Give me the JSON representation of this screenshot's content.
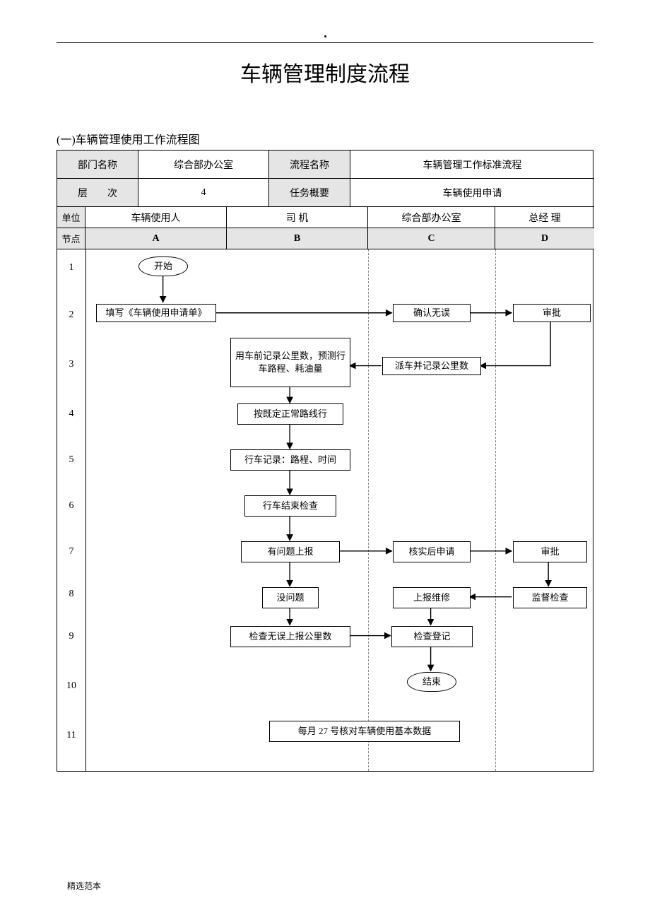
{
  "doc_title": "车辆管理制度流程",
  "section_title": "(一)车辆管理使用工作流程图",
  "footer": "精选范本",
  "header": {
    "dept_label": "部门名称",
    "dept_value": "综合部办公室",
    "flow_name_label": "流程名称",
    "flow_name_value": "车辆管理工作标准流程",
    "level_label": "层        次",
    "level_value": "4",
    "task_label": "任务概要",
    "task_value": "车辆使用申请",
    "unit_label": "单位",
    "node_label": "节点",
    "lanes": [
      {
        "unit": "车辆使用人",
        "node": "A"
      },
      {
        "unit": "司 机",
        "node": "B"
      },
      {
        "unit": "综合部办公室",
        "node": "C"
      },
      {
        "unit": "总经 理",
        "node": "D"
      }
    ]
  },
  "rows": [
    "1",
    "2",
    "3",
    "4",
    "5",
    "6",
    "7",
    "8",
    "9",
    "10",
    "11"
  ],
  "nodes": {
    "start": "开始",
    "a2": "填写《车辆使用申请单》",
    "c2": "确认无误",
    "d2": "审批",
    "b3": "用车前记录公里数，预测行车路程、耗油量",
    "c3": "派车并记录公里数",
    "b4": "按既定正常路线行",
    "b5": "行车记录：路程、时间",
    "b6": "行车结束检查",
    "b7": "有问题上报",
    "c7": "核实后申请",
    "d7": "审批",
    "b8": "没问题",
    "c8": "上报维修",
    "d8": "监督检查",
    "b9": "检查无误上报公里数",
    "c9": "检查登记",
    "end": "结束",
    "b11": "每月 27 号核对车辆使用基本数据"
  }
}
